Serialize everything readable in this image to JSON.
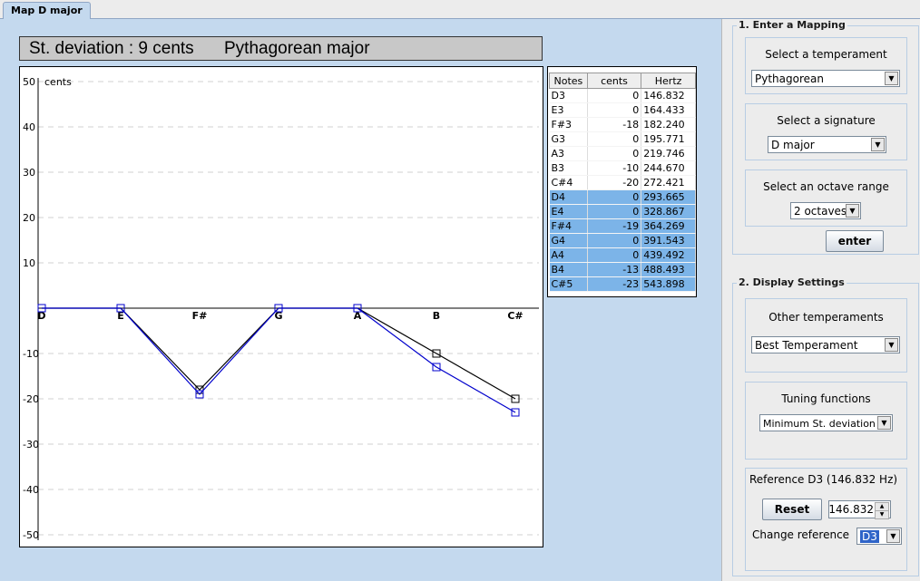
{
  "tab": {
    "label": "Map D major"
  },
  "header": {
    "deviation": "St. deviation : 9 cents",
    "temperament": "Pythagorean major"
  },
  "chart_data": {
    "type": "line",
    "ylabel": "cents",
    "ylim": [
      -50,
      50
    ],
    "yticks": [
      "50",
      "40",
      "30",
      "20",
      "10",
      "",
      "-10",
      "-20",
      "-30",
      "-40",
      "-50"
    ],
    "categories": [
      "D",
      "E",
      "F#",
      "G",
      "A",
      "B",
      "C#"
    ],
    "grid": true,
    "series": [
      {
        "values": [
          0,
          0,
          -18,
          0,
          0,
          -10,
          -20
        ],
        "color": "#000000"
      },
      {
        "values": [
          0,
          0,
          -19,
          0,
          0,
          -13,
          -23
        ],
        "color": "#0000cc"
      }
    ]
  },
  "notes_table": {
    "headers": [
      "Notes",
      "cents",
      "Hertz"
    ],
    "selected_color": "#7cb4e8",
    "rows": [
      {
        "note": "D3",
        "cents": "0",
        "hertz": "146.832",
        "selected": false
      },
      {
        "note": "E3",
        "cents": "0",
        "hertz": "164.433",
        "selected": false
      },
      {
        "note": "F#3",
        "cents": "-18",
        "hertz": "182.240",
        "selected": false
      },
      {
        "note": "G3",
        "cents": "0",
        "hertz": "195.771",
        "selected": false
      },
      {
        "note": "A3",
        "cents": "0",
        "hertz": "219.746",
        "selected": false
      },
      {
        "note": "B3",
        "cents": "-10",
        "hertz": "244.670",
        "selected": false
      },
      {
        "note": "C#4",
        "cents": "-20",
        "hertz": "272.421",
        "selected": false
      },
      {
        "note": "D4",
        "cents": "0",
        "hertz": "293.665",
        "selected": true
      },
      {
        "note": "E4",
        "cents": "0",
        "hertz": "328.867",
        "selected": true
      },
      {
        "note": "F#4",
        "cents": "-19",
        "hertz": "364.269",
        "selected": true
      },
      {
        "note": "G4",
        "cents": "0",
        "hertz": "391.543",
        "selected": true
      },
      {
        "note": "A4",
        "cents": "0",
        "hertz": "439.492",
        "selected": true
      },
      {
        "note": "B4",
        "cents": "-13",
        "hertz": "488.493",
        "selected": true
      },
      {
        "note": "C#5",
        "cents": "-23",
        "hertz": "543.898",
        "selected": true
      }
    ]
  },
  "mapping": {
    "title": "1. Enter a Mapping",
    "temperament_label": "Select a temperament",
    "temperament_value": "Pythagorean",
    "signature_label": "Select a signature",
    "signature_value": "D major",
    "octave_label": "Select an octave range",
    "octave_value": "2 octaves",
    "enter_label": "enter"
  },
  "display": {
    "title": "2. Display Settings",
    "other_label": "Other temperaments",
    "other_value": "Best Temperament",
    "tuning_label": "Tuning functions",
    "tuning_value": "Minimum St. deviation",
    "reference_label": "Reference D3 (146.832 Hz)",
    "reset_label": "Reset",
    "reference_value": "146.832",
    "change_label": "Change reference",
    "change_value": "D3"
  }
}
